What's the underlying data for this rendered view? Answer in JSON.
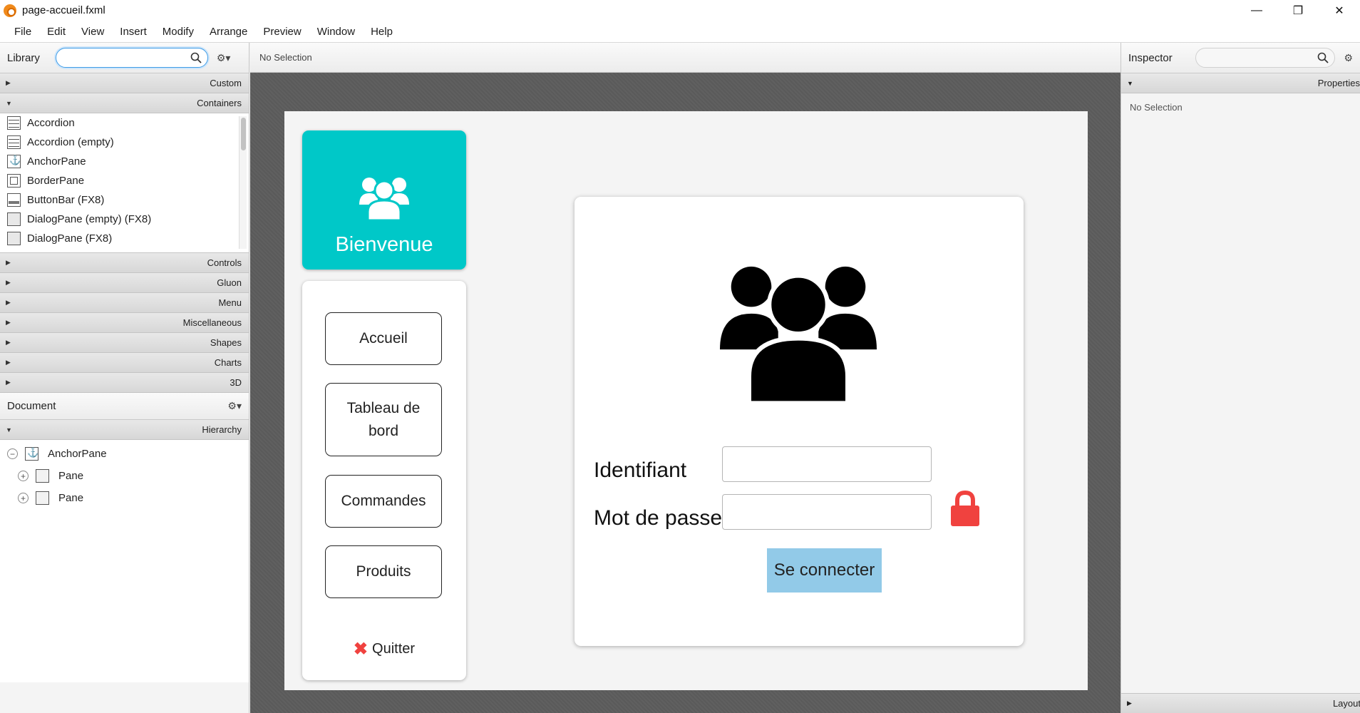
{
  "window": {
    "title": "page-accueil.fxml",
    "minimize": "—",
    "restore": "❐",
    "close": "✕"
  },
  "menu": [
    "File",
    "Edit",
    "View",
    "Insert",
    "Modify",
    "Arrange",
    "Preview",
    "Window",
    "Help"
  ],
  "library": {
    "title": "Library",
    "search_value": "",
    "sections_top": [
      "Custom",
      "Containers"
    ],
    "items": [
      {
        "label": "Accordion",
        "icon": "accordion"
      },
      {
        "label": "Accordion  (empty)",
        "icon": "accordion"
      },
      {
        "label": "AnchorPane",
        "icon": "anchor"
      },
      {
        "label": "BorderPane",
        "icon": "border"
      },
      {
        "label": "ButtonBar  (FX8)",
        "icon": "buttonbar"
      },
      {
        "label": "DialogPane (empty)  (FX8)",
        "icon": "dialog"
      },
      {
        "label": "DialogPane  (FX8)",
        "icon": "dialog"
      }
    ],
    "sections_bottom": [
      "Controls",
      "Gluon",
      "Menu",
      "Miscellaneous",
      "Shapes",
      "Charts",
      "3D"
    ]
  },
  "document": {
    "title": "Document",
    "hierarchy_label": "Hierarchy",
    "tree": [
      {
        "label": "AnchorPane",
        "toggle": "−",
        "icon": "anchor"
      },
      {
        "label": "Pane",
        "toggle": "+",
        "icon": "pane"
      },
      {
        "label": "Pane",
        "toggle": "+",
        "icon": "pane"
      }
    ]
  },
  "center": {
    "status": "No Selection"
  },
  "app": {
    "welcome": "Bienvenue",
    "nav": {
      "accueil": "Accueil",
      "tableau_line1": "Tableau de",
      "tableau_line2": "bord",
      "commandes": "Commandes",
      "produits": "Produits",
      "quitter": "Quitter"
    },
    "login": {
      "identifiant_label": "Identifiant",
      "password_label": "Mot de passe",
      "identifiant_value": "",
      "password_value": "",
      "connect": "Se connecter"
    },
    "colors": {
      "welcome_bg": "#00c8c8",
      "connect_bg": "#92cae8",
      "lock": "#f0423f"
    }
  },
  "inspector": {
    "title": "Inspector",
    "properties": "Properties",
    "no_selection": "No Selection",
    "layout": "Layout"
  }
}
